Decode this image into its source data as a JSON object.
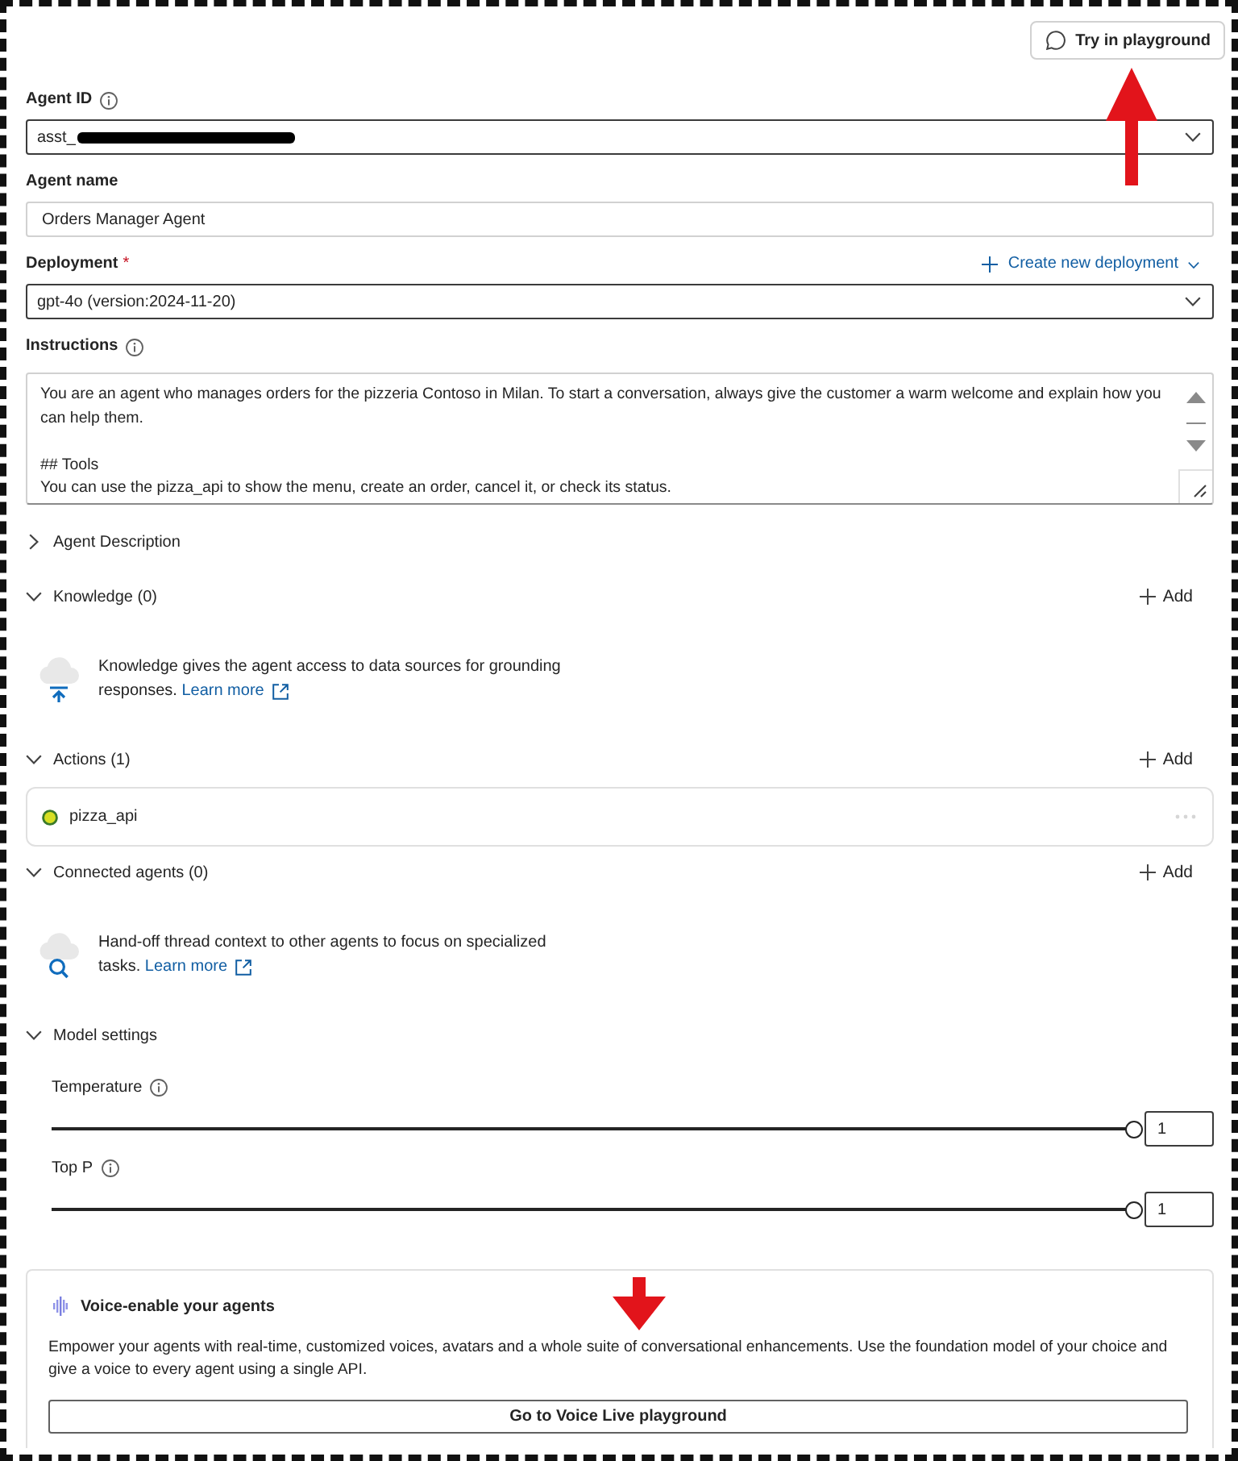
{
  "header": {
    "button": "Try in playground",
    "annotation_arrow": true
  },
  "fields": [
    {
      "kind": "dropdown",
      "label": "Agent ID",
      "info": true,
      "value": "asst_",
      "redacted": true
    },
    {
      "kind": "input",
      "label": "Agent name",
      "value": "Orders Manager Agent"
    },
    {
      "kind": "dropdown",
      "label": "Deployment",
      "required_mark": "*",
      "link": "Create new deployment",
      "value": "gpt-4o (version:2024-11-20)"
    },
    {
      "kind": "textarea",
      "label": "Instructions",
      "info": true,
      "value": "You are an agent who manages orders for the pizzeria Contoso in Milan. To start a conversation, always give the customer a warm welcome and explain how you can help them.\n\n## Tools\nYou can use the pizza_api to show the menu, create an order, cancel it, or check its status."
    }
  ],
  "sections": [
    {
      "title": "Agent Description",
      "expanded": false
    },
    {
      "title": "Knowledge (0)",
      "expanded": true,
      "add": "Add",
      "empty": {
        "kind": "upload",
        "text": "Knowledge gives the agent access to data sources for grounding responses.",
        "link": "Learn more"
      }
    },
    {
      "title": "Actions (1)",
      "expanded": true,
      "add": "Add",
      "items": [
        {
          "name": "pizza_api"
        }
      ]
    },
    {
      "title": "Connected agents (0)",
      "expanded": true,
      "add": "Add",
      "empty": {
        "kind": "search",
        "text": "Hand-off thread context to other agents to focus on specialized tasks.",
        "link": "Learn more"
      }
    },
    {
      "title": "Model settings",
      "expanded": true,
      "sliders": [
        {
          "label": "Temperature",
          "info": true,
          "level": 1,
          "value": "1"
        },
        {
          "label": "Top P",
          "info": true,
          "level": 1,
          "value": "1"
        }
      ]
    }
  ],
  "voice_card": {
    "title": "Voice-enable your agents",
    "text": "Empower your agents with real-time, customized voices, avatars and a whole suite of conversational enhancements. Use the foundation model of your choice and give a voice to every agent using a single API.",
    "button": "Go to Voice Live playground",
    "annotation_arrow": true
  }
}
